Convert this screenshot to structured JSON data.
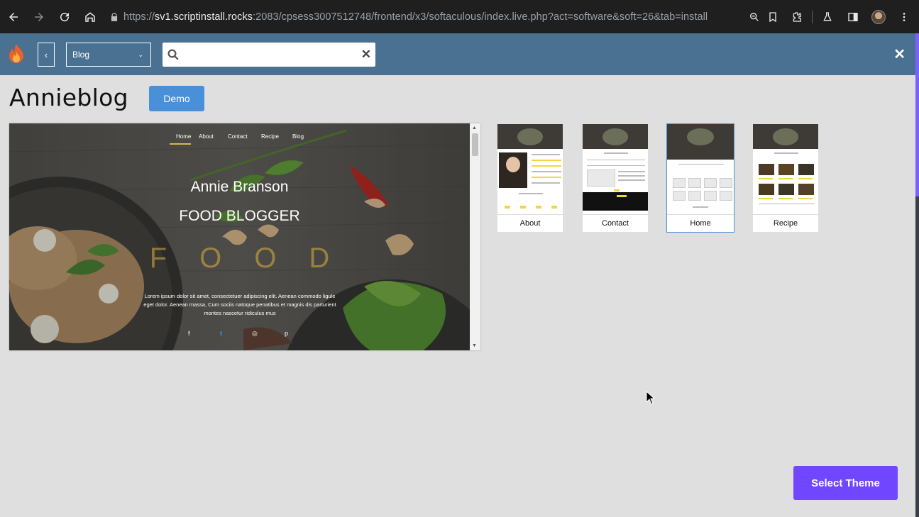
{
  "browser": {
    "url_protocol": "https://",
    "url_host": "sv1.scriptinstall.rocks",
    "url_rest": ":2083/cpsess3007512748/frontend/x3/softaculous/index.live.php?act=software&soft=26&tab=install"
  },
  "header": {
    "category_value": "Blog",
    "search_placeholder": "",
    "back_glyph": "‹",
    "clear_glyph": "✕",
    "close_glyph": "✕"
  },
  "theme": {
    "title": "Annieblog",
    "demo_label": "Demo"
  },
  "preview": {
    "nav": [
      "Home",
      "About",
      "Contact",
      "Recipe",
      "Blog"
    ],
    "hero_name": "Annie Branson",
    "hero_subtitle": "FOOD BLOGGER",
    "hero_watermark": "FOOD",
    "hero_text": "Lorem ipsum dolor sit amet, consectetuer adipiscing elit. Aenean commodo ligule eget dolor. Aenean massa, Cum sociis natoque penatibus et magnis dis parturient montes nascetur ridiculus mus",
    "socials": [
      "f",
      "t",
      "◎",
      "p"
    ]
  },
  "thumbnails": [
    {
      "label": "About",
      "selected": false
    },
    {
      "label": "Contact",
      "selected": false
    },
    {
      "label": "Home",
      "selected": true
    },
    {
      "label": "Recipe",
      "selected": false
    }
  ],
  "actions": {
    "select_theme_label": "Select Theme"
  },
  "colors": {
    "header_bg": "#4a7192",
    "demo_bg": "#4a90d9",
    "select_theme_bg": "#7047ff",
    "watermark": "#dab23c"
  }
}
